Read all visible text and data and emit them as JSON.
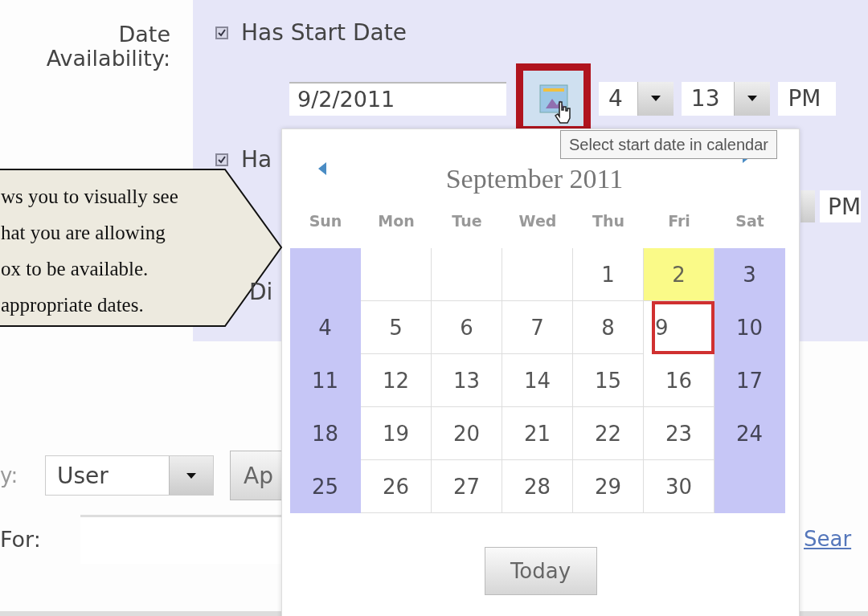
{
  "form": {
    "date_availability_label": "Date Availability:",
    "start_date": {
      "checkbox_label": "Has Start Date",
      "checked": true,
      "value": "9/2/2011",
      "hour": "4",
      "minute": "13",
      "ampm": "PM"
    },
    "second_date": {
      "checkbox_label": "Ha",
      "checked": true,
      "ampm": "PM"
    },
    "third_option": {
      "label": "Di"
    },
    "filter": {
      "label": "y:",
      "select_value": "User",
      "button_label": "Ap"
    },
    "search": {
      "label": "For:",
      "link": "Sear"
    }
  },
  "tooltip": "Select start date in calendar",
  "callout": {
    "lines": [
      "ws you to visually see",
      "hat you are allowing",
      "ox to be available.",
      "appropriate dates."
    ]
  },
  "calendar": {
    "month_title": "September 2011",
    "weekdays": [
      "Sun",
      "Mon",
      "Tue",
      "Wed",
      "Thu",
      "Fri",
      "Sat"
    ],
    "weeks": [
      [
        {
          "kind": "empty"
        },
        {
          "kind": "empty"
        },
        {
          "kind": "empty"
        },
        {
          "kind": "empty"
        },
        {
          "kind": "day",
          "day": "1",
          "today": false,
          "selected": false
        },
        {
          "kind": "day",
          "day": "2",
          "today": true,
          "selected": false
        },
        {
          "kind": "day",
          "day": "3",
          "today": false,
          "selected": false
        }
      ],
      [
        {
          "kind": "day",
          "day": "4",
          "today": false,
          "selected": false
        },
        {
          "kind": "day",
          "day": "5",
          "today": false,
          "selected": false
        },
        {
          "kind": "day",
          "day": "6",
          "today": false,
          "selected": false
        },
        {
          "kind": "day",
          "day": "7",
          "today": false,
          "selected": false
        },
        {
          "kind": "day",
          "day": "8",
          "today": false,
          "selected": false
        },
        {
          "kind": "day",
          "day": "9",
          "today": false,
          "selected": true
        },
        {
          "kind": "day",
          "day": "10",
          "today": false,
          "selected": false
        }
      ],
      [
        {
          "kind": "day",
          "day": "11",
          "today": false,
          "selected": false
        },
        {
          "kind": "day",
          "day": "12",
          "today": false,
          "selected": false
        },
        {
          "kind": "day",
          "day": "13",
          "today": false,
          "selected": false
        },
        {
          "kind": "day",
          "day": "14",
          "today": false,
          "selected": false
        },
        {
          "kind": "day",
          "day": "15",
          "today": false,
          "selected": false
        },
        {
          "kind": "day",
          "day": "16",
          "today": false,
          "selected": false
        },
        {
          "kind": "day",
          "day": "17",
          "today": false,
          "selected": false
        }
      ],
      [
        {
          "kind": "day",
          "day": "18",
          "today": false,
          "selected": false
        },
        {
          "kind": "day",
          "day": "19",
          "today": false,
          "selected": false
        },
        {
          "kind": "day",
          "day": "20",
          "today": false,
          "selected": false
        },
        {
          "kind": "day",
          "day": "21",
          "today": false,
          "selected": false
        },
        {
          "kind": "day",
          "day": "22",
          "today": false,
          "selected": false
        },
        {
          "kind": "day",
          "day": "23",
          "today": false,
          "selected": false
        },
        {
          "kind": "day",
          "day": "24",
          "today": false,
          "selected": false
        }
      ],
      [
        {
          "kind": "day",
          "day": "25",
          "today": false,
          "selected": false
        },
        {
          "kind": "day",
          "day": "26",
          "today": false,
          "selected": false
        },
        {
          "kind": "day",
          "day": "27",
          "today": false,
          "selected": false
        },
        {
          "kind": "day",
          "day": "28",
          "today": false,
          "selected": false
        },
        {
          "kind": "day",
          "day": "29",
          "today": false,
          "selected": false
        },
        {
          "kind": "day",
          "day": "30",
          "today": false,
          "selected": false
        },
        {
          "kind": "empty"
        }
      ]
    ],
    "today_button": "Today"
  }
}
